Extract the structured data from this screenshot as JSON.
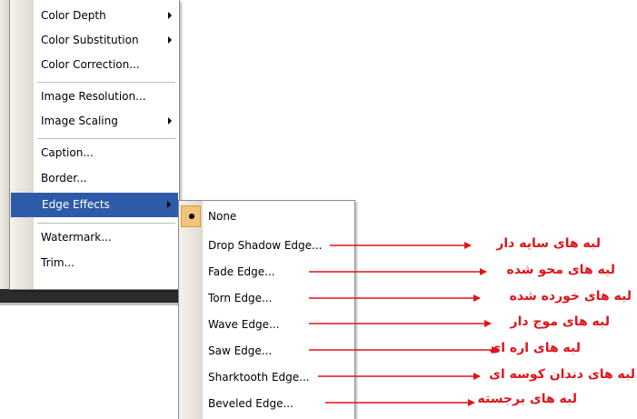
{
  "main_menu": {
    "items": [
      {
        "label": "Color Depth",
        "submenu": true
      },
      {
        "label": "Color Substitution",
        "submenu": true
      },
      {
        "label": "Color Correction..."
      },
      {
        "label": "Image Resolution..."
      },
      {
        "label": "Image Scaling",
        "submenu": true
      },
      {
        "label": "Caption..."
      },
      {
        "label": "Border..."
      },
      {
        "label": "Edge Effects",
        "submenu": true,
        "highlighted": true
      },
      {
        "label": "Watermark..."
      },
      {
        "label": "Trim..."
      }
    ]
  },
  "edge_submenu": {
    "items": [
      {
        "label": "None",
        "checked": true
      },
      {
        "label": "Drop Shadow Edge..."
      },
      {
        "label": "Fade Edge..."
      },
      {
        "label": "Torn Edge..."
      },
      {
        "label": "Wave Edge..."
      },
      {
        "label": "Saw Edge..."
      },
      {
        "label": "Sharktooth Edge..."
      },
      {
        "label": "Beveled Edge..."
      }
    ]
  },
  "annotations": [
    "لبه های سایه دار",
    "لبه های محو شده",
    "لبه های خورده شده",
    "لبه های موج دار",
    "لبه های اره ای",
    "لبه های دندان کوسه ای",
    "لبه های برجسته"
  ],
  "colors": {
    "highlight": "#2e5ba8",
    "annotation": "#e0141a",
    "check_bg": "#f0c47a"
  }
}
